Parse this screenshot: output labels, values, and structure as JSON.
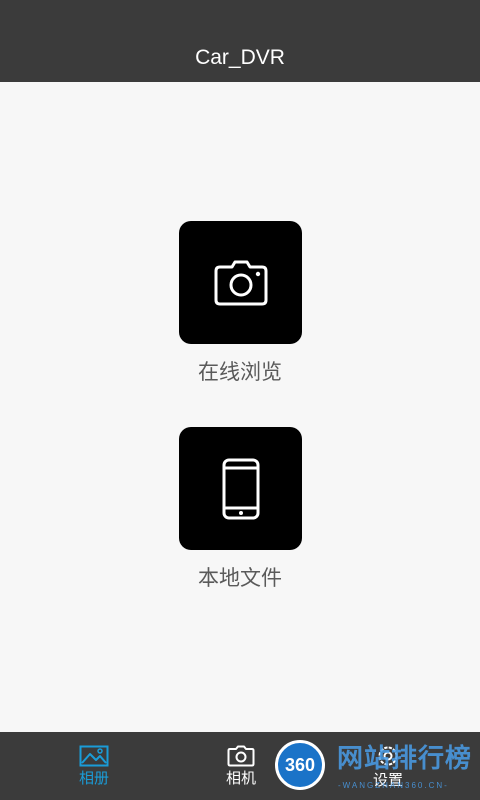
{
  "app": {
    "title": "Car_DVR"
  },
  "menu": {
    "online_label": "在线浏览",
    "local_label": "本地文件",
    "online_icon": "camera-icon",
    "local_icon": "phone-icon"
  },
  "tabs": [
    {
      "label": "相册",
      "icon": "album-icon",
      "active": true
    },
    {
      "label": "相机",
      "icon": "camera-icon",
      "active": false
    },
    {
      "label": "设置",
      "icon": "gear-icon",
      "active": false
    }
  ],
  "colors": {
    "bar": "#3b3b3b",
    "background": "#f7f7f7",
    "tile": "#000000",
    "active_tab": "#1a9cd8"
  },
  "watermark": {
    "badge": "360",
    "text": "网站排行榜",
    "sub": "-WANGZHAN360.CN-"
  }
}
